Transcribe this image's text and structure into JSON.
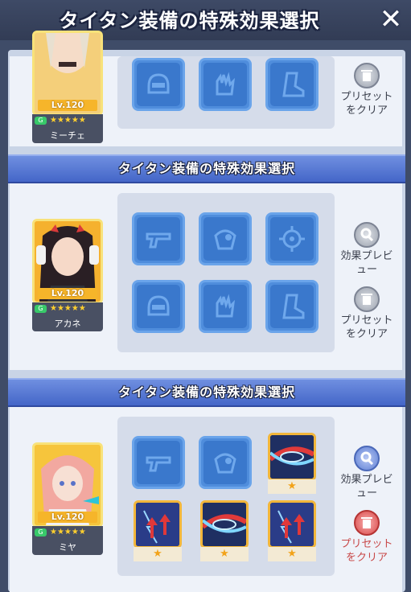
{
  "header": {
    "title": "タイタン装備の特殊効果選択",
    "close_glyph": "✕"
  },
  "sections": [
    {
      "title": "",
      "character": {
        "name": "ミーチェ",
        "level": "Lv.120",
        "stars": "★★★★★"
      },
      "buttons": {
        "clear": "プリセット\nをクリア"
      }
    },
    {
      "title": "タイタン装備の特殊効果選択",
      "character": {
        "name": "アカネ",
        "level": "Lv.120",
        "stars": "★★★★★"
      },
      "buttons": {
        "preview": "効果プレビ\nュー",
        "clear": "プリセット\nをクリア"
      }
    },
    {
      "title": "タイタン装備の特殊効果選択",
      "character": {
        "name": "ミヤ",
        "level": "Lv.120",
        "stars": "★★★★★"
      },
      "buttons": {
        "preview": "効果プレビ\nュー",
        "clear": "プリセット\nをクリア"
      }
    }
  ],
  "chip_star": "★",
  "badge_glyph": "G",
  "colors": {
    "header_blue": "#4466c8",
    "slot_blue": "#4f8ddc",
    "gold": "#f2b63b",
    "clear_red": "#d94848"
  }
}
